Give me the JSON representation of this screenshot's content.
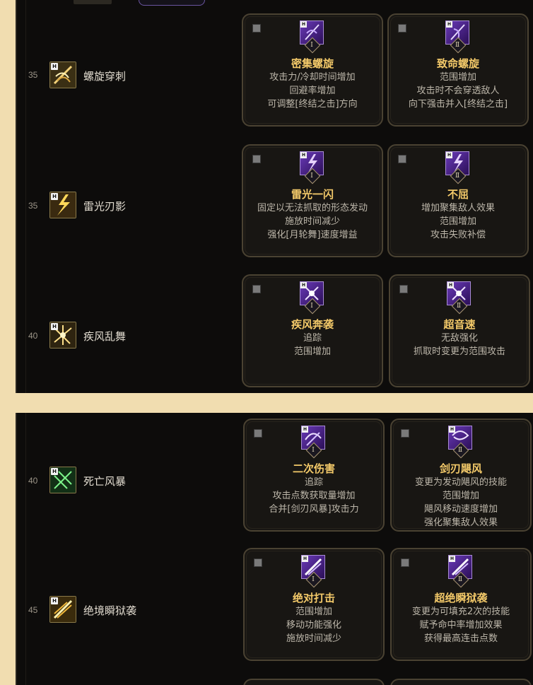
{
  "panels": [
    {
      "rows": [
        {
          "level": "35",
          "skill": "螺旋穿刺",
          "icon": "spiral-thrust-icon",
          "cards": [
            {
              "title": "密集螺旋",
              "lines": [
                "攻击力/冷却时间增加",
                "回避率增加",
                "可调整[终结之击]方向"
              ]
            },
            {
              "title": "致命螺旋",
              "lines": [
                "范围增加",
                "攻击时不会穿透敌人",
                "向下强击并入[终结之击]"
              ]
            }
          ]
        },
        {
          "level": "35",
          "skill": "雷光刃影",
          "icon": "lightning-blade-icon",
          "cards": [
            {
              "title": "雷光一闪",
              "lines": [
                "固定以无法抓取的形态发动",
                "施放时间减少",
                "强化[月轮舞]速度增益"
              ]
            },
            {
              "title": "不屈",
              "lines": [
                "增加聚集敌人效果",
                "范围增加",
                "攻击失败补偿"
              ]
            }
          ]
        },
        {
          "level": "40",
          "skill": "疾风乱舞",
          "icon": "gale-dance-icon",
          "cards": [
            {
              "title": "疾风奔袭",
              "lines": [
                "追踪",
                "范围增加"
              ]
            },
            {
              "title": "超音速",
              "lines": [
                "无敌强化",
                "抓取时变更为范围攻击"
              ]
            }
          ]
        }
      ]
    },
    {
      "rows": [
        {
          "level": "40",
          "skill": "死亡风暴",
          "icon": "death-storm-icon",
          "cards": [
            {
              "title": "二次伤害",
              "lines": [
                "追踪",
                "攻击点数获取量增加",
                "合并[剑刃风暴]攻击力"
              ]
            },
            {
              "title": "剑刃飓风",
              "lines": [
                "变更为发动飓风的技能",
                "范围增加",
                "飓风移动速度增加",
                "强化聚集敌人效果"
              ]
            }
          ]
        },
        {
          "level": "45",
          "skill": "绝境瞬狱袭",
          "icon": "desperate-strike-icon",
          "cards": [
            {
              "title": "绝对打击",
              "lines": [
                "范围增加",
                "移动功能强化",
                "施放时间减少"
              ]
            },
            {
              "title": "超绝瞬狱袭",
              "lines": [
                "变更为可填充2次的技能",
                "赋予命中率增加效果",
                "获得最高连击点数"
              ]
            }
          ]
        }
      ]
    }
  ],
  "badges": {
    "h": "H",
    "tier1": "Ⅰ",
    "tier2": "Ⅱ"
  },
  "colors": {
    "title": "#f3c969",
    "desc": "#bdb7aa",
    "panel": "#0d0c0b",
    "page": "#f1ddb0",
    "card_border": "#4a4232",
    "icon_purple": "#6a3ab8"
  }
}
